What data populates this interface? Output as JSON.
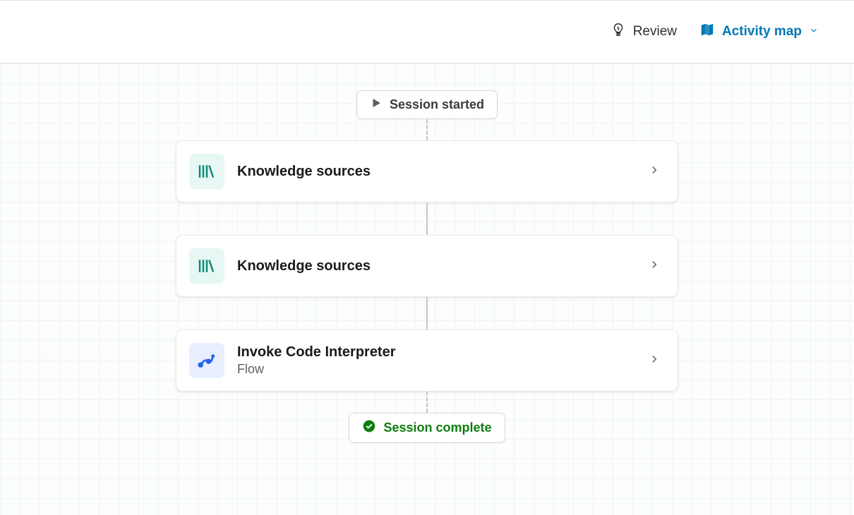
{
  "topbar": {
    "review_label": "Review",
    "activity_map_label": "Activity map"
  },
  "flow": {
    "start_label": "Session started",
    "end_label": "Session complete",
    "nodes": [
      {
        "title": "Knowledge sources",
        "subtitle": "",
        "icon": "knowledge"
      },
      {
        "title": "Knowledge sources",
        "subtitle": "",
        "icon": "knowledge"
      },
      {
        "title": "Invoke Code Interpreter",
        "subtitle": "Flow",
        "icon": "flow"
      }
    ]
  },
  "colors": {
    "accent": "#0078b4",
    "success": "#107c10",
    "knowledge_icon": "#0e8a76",
    "flow_icon": "#2563eb"
  }
}
